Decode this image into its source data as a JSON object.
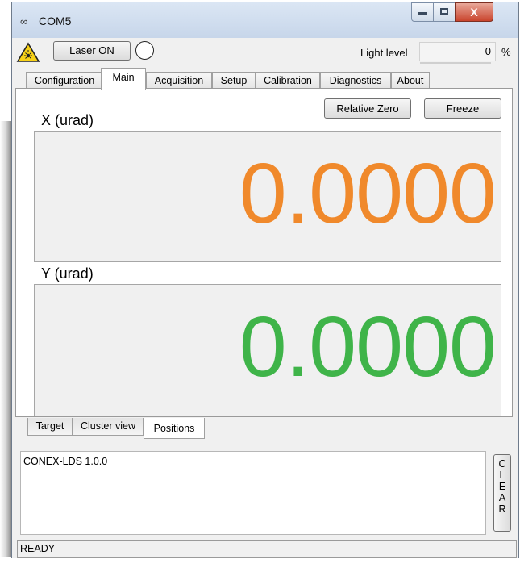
{
  "window": {
    "title": "COM5",
    "title_icon": "serial-link-icon"
  },
  "toolbar": {
    "laser_button": "Laser ON",
    "light_level_label": "Light level",
    "light_level_value": "0",
    "light_level_unit": "%"
  },
  "tabs": [
    {
      "label": "Configuration"
    },
    {
      "label": "Main"
    },
    {
      "label": "Acquisition"
    },
    {
      "label": "Setup"
    },
    {
      "label": "Calibration"
    },
    {
      "label": "Diagnostics"
    },
    {
      "label": "About"
    }
  ],
  "main": {
    "relative_zero": "Relative Zero",
    "freeze": "Freeze",
    "x_label": "X (urad)",
    "x_value": "0.0000",
    "y_label": "Y (urad)",
    "y_value": "0.0000",
    "colors": {
      "x_value": "#f0892b",
      "y_value": "#3fb449"
    }
  },
  "subtabs": [
    {
      "label": "Target"
    },
    {
      "label": "Cluster view"
    },
    {
      "label": "Positions"
    }
  ],
  "log": {
    "text": "CONEX-LDS 1.0.0"
  },
  "clear_button": [
    "C",
    "L",
    "E",
    "A",
    "R"
  ],
  "status": {
    "text": "READY"
  }
}
